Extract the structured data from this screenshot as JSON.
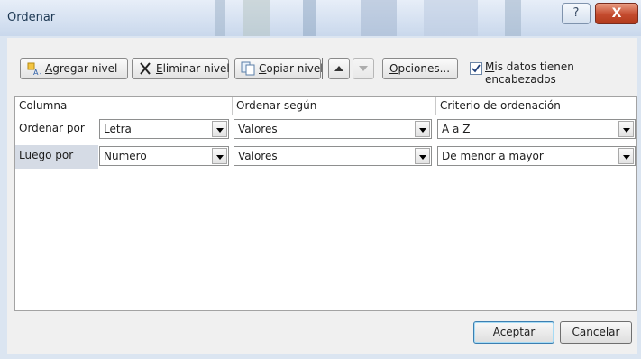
{
  "window": {
    "title": "Ordenar",
    "help_glyph": "?",
    "close_glyph": "X"
  },
  "toolbar": {
    "add_level": {
      "icon": "add-level-icon",
      "label_prefix": "",
      "label_mnemonic": "A",
      "label_rest": "gregar nivel"
    },
    "delete_level": {
      "icon": "delete-x-icon",
      "label_mnemonic": "E",
      "label_rest": "liminar nivel"
    },
    "copy_level": {
      "icon": "copy-icon",
      "label_mnemonic": "C",
      "label_rest": "opiar nivel"
    },
    "move_up": {
      "icon": "arrow-up-icon"
    },
    "move_down": {
      "icon": "arrow-down-icon"
    },
    "options": {
      "label_mnemonic": "O",
      "label_rest": "pciones..."
    },
    "headers_checkbox": {
      "checked": true,
      "label_mnemonic": "M",
      "label_rest": "is datos tienen encabezados"
    }
  },
  "grid": {
    "headers": [
      "Columna",
      "Ordenar según",
      "Criterio de ordenación"
    ],
    "rows": [
      {
        "label": "Ordenar por",
        "column": "Letra",
        "sort_on": "Valores",
        "order": "A a Z",
        "selected": false
      },
      {
        "label": "Luego por",
        "column": "Numero",
        "sort_on": "Valores",
        "order": "De menor a mayor",
        "selected": true
      }
    ]
  },
  "footer": {
    "ok": "Aceptar",
    "cancel": "Cancelar"
  },
  "colors": {
    "title_bar": "#c9d8ec",
    "close_button": "#c44b2e",
    "accent_border": "#3c7fb1",
    "selected_row": "#d5dbe5"
  }
}
